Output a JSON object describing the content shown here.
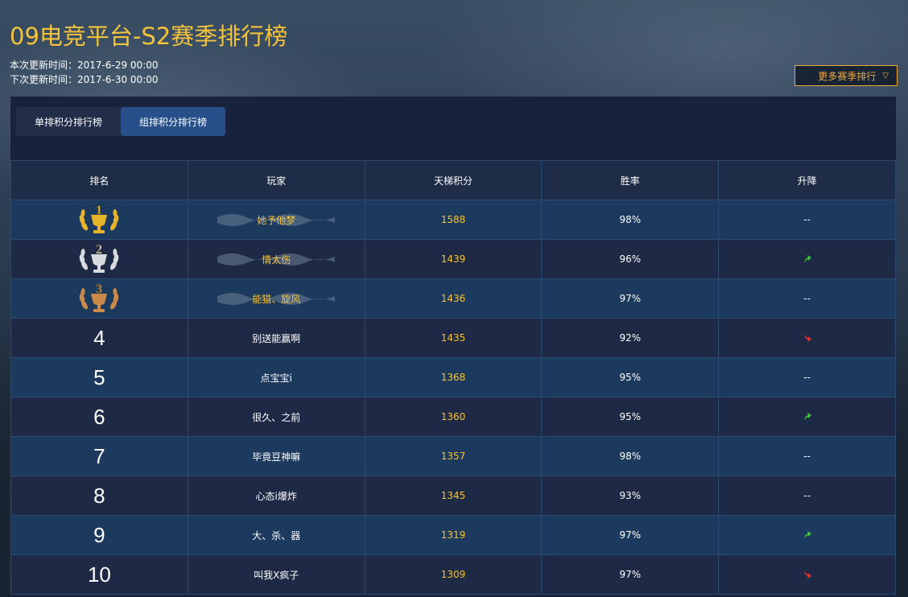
{
  "title": "09电竞平台-S2赛季排行榜",
  "update": {
    "current": "本次更新时间：2017-6-29 00:00",
    "next": "下次更新时间：2017-6-30 00:00"
  },
  "more_button": {
    "label": "更多赛季排行",
    "icon": "chevron-down-icon"
  },
  "tabs": [
    {
      "label": "单排积分排行榜",
      "active": false
    },
    {
      "label": "组排积分排行榜",
      "active": true
    }
  ],
  "table": {
    "headers": [
      "排名",
      "玩家",
      "天梯积分",
      "胜率",
      "升降"
    ],
    "rows": [
      {
        "rank": "1",
        "medal": "gold",
        "player": "她予他梦",
        "score": "1588",
        "rate": "98%",
        "change": "--"
      },
      {
        "rank": "2",
        "medal": "silver",
        "player": "情太伤",
        "score": "1439",
        "rate": "96%",
        "change": "up"
      },
      {
        "rank": "3",
        "medal": "bronze",
        "player": "能猫、旋风",
        "score": "1436",
        "rate": "97%",
        "change": "--"
      },
      {
        "rank": "4",
        "player": "别送能赢啊",
        "score": "1435",
        "rate": "92%",
        "change": "down"
      },
      {
        "rank": "5",
        "player": "点宝宝i",
        "score": "1368",
        "rate": "95%",
        "change": "--"
      },
      {
        "rank": "6",
        "player": "很久、之前",
        "score": "1360",
        "rate": "95%",
        "change": "up"
      },
      {
        "rank": "7",
        "player": "毕竟豆神嘛",
        "score": "1357",
        "rate": "98%",
        "change": "--"
      },
      {
        "rank": "8",
        "player": "心态i爆炸",
        "score": "1345",
        "rate": "93%",
        "change": "--"
      },
      {
        "rank": "9",
        "player": "大、杀、器",
        "score": "1319",
        "rate": "97%",
        "change": "up"
      },
      {
        "rank": "10",
        "player": "叫我X疯子",
        "score": "1309",
        "rate": "97%",
        "change": "down"
      }
    ]
  },
  "colors": {
    "title": "#f5c33b",
    "score": "#f5c33b",
    "up_arrow": "#3ec83e",
    "down_arrow": "#e8332a",
    "gold": "#e6b52c",
    "silver": "#d7dbe0",
    "bronze": "#c98a4a"
  }
}
